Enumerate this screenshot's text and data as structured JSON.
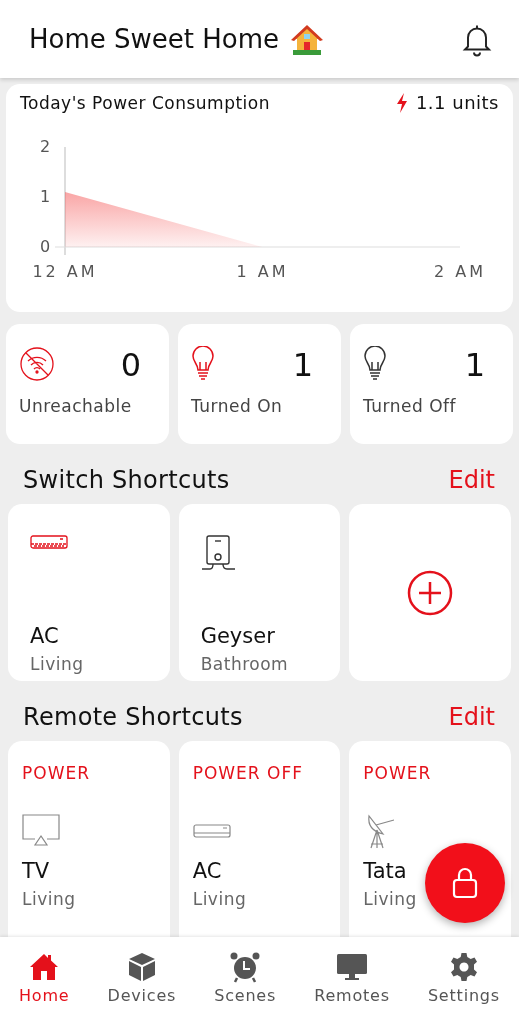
{
  "header": {
    "title": "Home Sweet Home"
  },
  "consumption": {
    "title": "Today's Power Consumption",
    "total": "1.1 units",
    "chart_data": {
      "type": "area",
      "categories": [
        "12 AM",
        "1 AM",
        "2 AM"
      ],
      "series": [
        {
          "color": "#f44c4c",
          "values": [
            1.1,
            0,
            0
          ]
        }
      ],
      "ylim": [
        0,
        2
      ],
      "yticks": [
        0,
        1,
        2
      ]
    }
  },
  "stats": [
    {
      "kind": "unreachable",
      "count": "0",
      "label": "Unreachable"
    },
    {
      "kind": "on",
      "count": "1",
      "label": "Turned On"
    },
    {
      "kind": "off",
      "count": "1",
      "label": "Turned Off"
    }
  ],
  "switch_shortcuts": {
    "title": "Switch Shortcuts",
    "action": "Edit",
    "items": [
      {
        "kind": "ac",
        "on": true,
        "name": "AC",
        "room": "Living"
      },
      {
        "kind": "geyser",
        "on": false,
        "name": "Geyser",
        "room": "Bathroom"
      },
      {
        "kind": "add"
      }
    ]
  },
  "remote_shortcuts": {
    "title": "Remote Shortcuts",
    "action": "Edit",
    "items": [
      {
        "kind": "tv",
        "command": "POWER",
        "name": "TV",
        "room": "Living"
      },
      {
        "kind": "ac",
        "command": "POWER OFF",
        "name": "AC",
        "room": "Living"
      },
      {
        "kind": "dish",
        "command": "POWER",
        "name": "Tata",
        "room": "Living"
      }
    ]
  },
  "nav": [
    {
      "kind": "home",
      "label": "Home",
      "selected": true
    },
    {
      "kind": "devices",
      "label": "Devices",
      "selected": false
    },
    {
      "kind": "scenes",
      "label": "Scenes",
      "selected": false
    },
    {
      "kind": "remotes",
      "label": "Remotes",
      "selected": false
    },
    {
      "kind": "settings",
      "label": "Settings",
      "selected": false
    }
  ]
}
